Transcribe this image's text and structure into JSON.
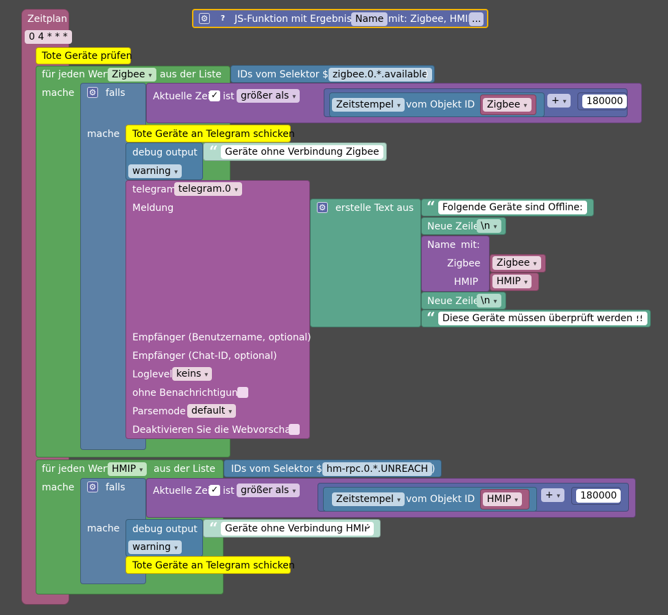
{
  "schedule": {
    "label": "Zeitplan",
    "cron": "0 4 * * *"
  },
  "function_block": {
    "label_pre": "JS-Funktion mit Ergebnis",
    "name_field": "Name",
    "label_post": "mit: Zigbee, HMIP",
    "more": "..."
  },
  "comments": {
    "check_devices": "Tote Geräte prüfen",
    "send_telegram": "Tote Geräte an Telegram schicken"
  },
  "loop1": {
    "for_each": "für jeden Wert",
    "var": "Zigbee",
    "from_list": "aus der Liste",
    "selector_pre": "IDs vom Selektor $(",
    "selector": "zigbee.0.*.available",
    "selector_post": ")",
    "do": "mache"
  },
  "if1": {
    "if": "falls",
    "current_time": "Aktuelle Zeit",
    "is": "ist",
    "compare": "größer als",
    "timestamp": "Zeitstempel",
    "of_object": "vom Objekt ID",
    "var": "Zigbee",
    "op": "+",
    "value": "180000",
    "do": "mache"
  },
  "debug1": {
    "label": "debug output",
    "text": "Geräte ohne Verbindung Zigbee",
    "level": "warning"
  },
  "telegram": {
    "label": "telegram",
    "instance": "telegram.0",
    "message": "Meldung",
    "recipient_user": "Empfänger (Benutzername, optional)",
    "recipient_chat": "Empfänger (Chat-ID, optional)",
    "loglevel": "Loglevel",
    "loglevel_value": "keins",
    "silent": "ohne Benachrichtigung",
    "parsemode": "Parsemode",
    "parsemode_value": "default",
    "disable_preview": "Deaktivieren Sie die Webvorschau"
  },
  "text_join": {
    "label": "erstelle Text aus",
    "line1": "Folgende Geräte sind Offline:",
    "newline": "Neue Zeile",
    "newline_value": "\\n",
    "name_with": "Name",
    "mit": "mit:",
    "param1_label": "Zigbee",
    "param1_value": "Zigbee",
    "param2_label": "HMIP",
    "param2_value": "HMIP",
    "line2": "Diese Geräte müssen überprüft werden !!"
  },
  "loop2": {
    "for_each": "für jeden Wert",
    "var": "HMIP",
    "from_list": "aus der Liste",
    "selector_pre": "IDs vom Selektor $(",
    "selector": "hm-rpc.0.*.UNREACH",
    "selector_post": ")",
    "do": "mache"
  },
  "if2": {
    "if": "falls",
    "current_time": "Aktuelle Zeit",
    "is": "ist",
    "compare": "größer als",
    "timestamp": "Zeitstempel",
    "of_object": "vom Objekt ID",
    "var": "HMIP",
    "op": "+",
    "value": "180000",
    "do": "mache"
  },
  "debug2": {
    "label": "debug output",
    "text": "Geräte ohne Verbindung HMIP",
    "level": "warning"
  },
  "check_mark": "✓",
  "colors": {
    "schedule": "#a55b80",
    "loop": "#5ba55b",
    "if": "#5b80a5",
    "compare": "#8a5aa2",
    "text": "#5ba58c",
    "telegram": "#a05a9c",
    "comment": "#ffff00"
  }
}
